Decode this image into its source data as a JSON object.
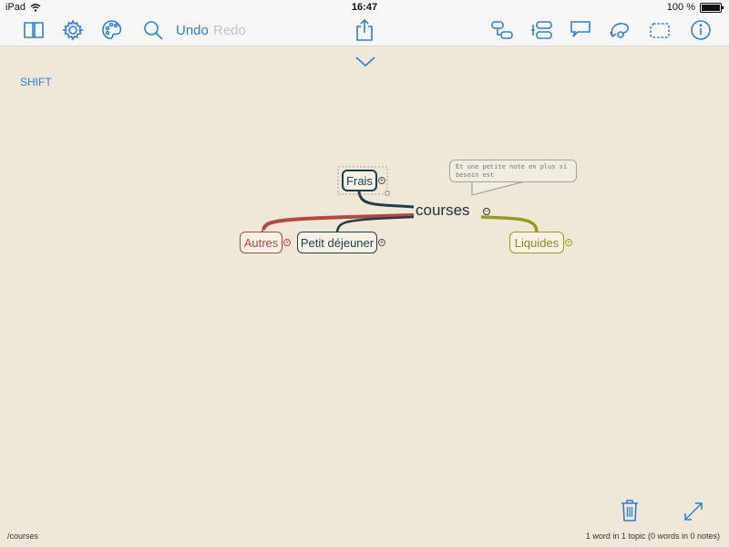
{
  "status": {
    "device": "iPad",
    "time": "16:47",
    "battery": "100 %"
  },
  "toolbar": {
    "undo": "Undo",
    "redo": "Redo",
    "icons": [
      "book-icon",
      "gear-icon",
      "palette-icon",
      "search-icon",
      "share-icon",
      "add-sibling-icon",
      "add-child-icon",
      "callout-icon",
      "relationship-icon",
      "boundary-icon",
      "info-icon"
    ]
  },
  "canvas": {
    "shift_label": "SHIFT"
  },
  "mindmap": {
    "central": "courses",
    "topics": {
      "frais": "Frais",
      "autres": "Autres",
      "petit_dejeuner": "Petit déjeuner",
      "liquides": "Liquides"
    },
    "note": "Et une petite note en plus si besoin est"
  },
  "colors": {
    "accent": "#2f7fd6",
    "dark_branch": "#1e3e4a",
    "red_branch": "#b5473f",
    "olive_branch": "#9a9a1e",
    "background": "#efe8d8"
  },
  "footer": {
    "path": "/courses",
    "stats": "1 word in 1 topic (0 words in 0 notes)"
  }
}
